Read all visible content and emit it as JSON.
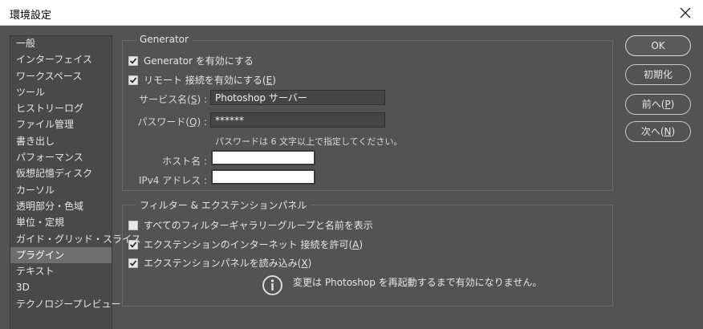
{
  "window": {
    "title": "環境設定",
    "close_icon": "close-icon"
  },
  "sidebar": {
    "items": [
      {
        "label": "一般"
      },
      {
        "label": "インターフェイス"
      },
      {
        "label": "ワークスペース"
      },
      {
        "label": "ツール"
      },
      {
        "label": "ヒストリーログ"
      },
      {
        "label": "ファイル管理"
      },
      {
        "label": "書き出し"
      },
      {
        "label": "パフォーマンス"
      },
      {
        "label": "仮想記憶ディスク"
      },
      {
        "label": "カーソル"
      },
      {
        "label": "透明部分・色域"
      },
      {
        "label": "単位・定規"
      },
      {
        "label": "ガイド・グリッド・スライス"
      },
      {
        "label": "プラグイン",
        "selected": true
      },
      {
        "label": "テキスト"
      },
      {
        "label": "3D"
      },
      {
        "label": "テクノロジープレビュー"
      }
    ]
  },
  "generator": {
    "legend": "Generator",
    "enable": {
      "label": "Generator を有効にする",
      "checked": true
    },
    "remote": {
      "label_pre": "リモート 接続を有効にする(",
      "key": "E",
      "label_post": ")",
      "checked": true
    },
    "service_name": {
      "label_pre": "サービス名(",
      "key": "S",
      "label_post": ") :",
      "value": "Photoshop サーバー"
    },
    "password": {
      "label_pre": "パスワード(",
      "key": "Q",
      "label_post": ") :",
      "value": "******"
    },
    "password_note": "パスワードは 6 文字以上で指定してください。",
    "host_label": "ホスト名 :",
    "ipv4_label": "IPv4 アドレス :"
  },
  "filters": {
    "legend": "フィルター & エクステンションパネル",
    "show_all": {
      "label": "すべてのフィルターギャラリーグループと名前を表示",
      "checked": false
    },
    "allow_net": {
      "label_pre": "エクステンションのインターネット 接続を許可(",
      "key": "A",
      "label_post": ")",
      "checked": true
    },
    "load_ext": {
      "label_pre": "エクステンションパネルを読み込み(",
      "key": "X",
      "label_post": ")",
      "checked": true
    },
    "info_icon": "info-icon",
    "info_text": "変更は Photoshop を再起動するまで有効になりません。"
  },
  "buttons": {
    "ok": "OK",
    "reset": "初期化",
    "prev_pre": "前へ(",
    "prev_key": "P",
    "prev_post": ")",
    "next_pre": "次へ(",
    "next_key": "N",
    "next_post": ")"
  },
  "colors": {
    "dialog_bg": "#535353",
    "sidebar_bg": "#494949",
    "selected_bg": "#6e6e6e",
    "field_bg": "#454545"
  }
}
